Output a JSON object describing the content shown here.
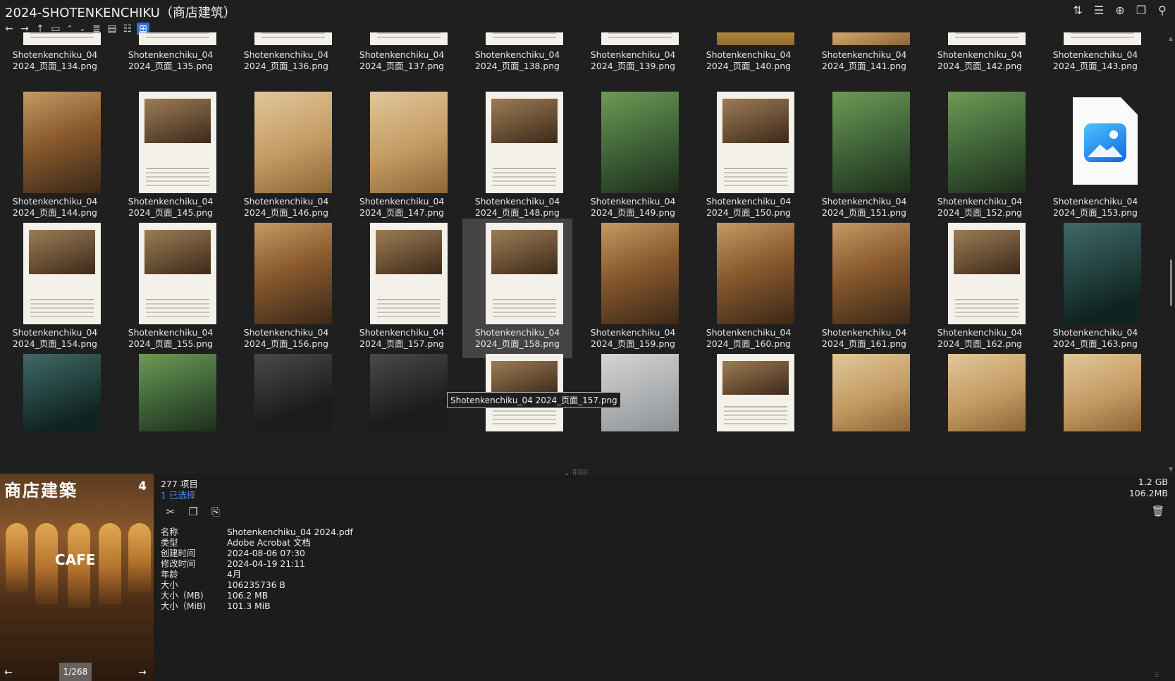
{
  "window": {
    "title": "2024-SHOTENKENCHIKU（商店建筑）",
    "tools": [
      "sort-icon",
      "view-options-icon",
      "add-icon",
      "copy-window-icon",
      "pin-icon"
    ]
  },
  "navbar": [
    "back-icon",
    "forward-icon",
    "up-icon",
    "panel-icon",
    "collapse-icon",
    "expand-icon",
    "details-view-icon",
    "list-view-icon",
    "tree-view-icon",
    "thumbnails-view-icon"
  ],
  "tiles": [
    {
      "line1": "Shotenkenchiku_04",
      "line2": "2024_页面_134.png",
      "style": "paper"
    },
    {
      "line1": "Shotenkenchiku_04",
      "line2": "2024_页面_135.png",
      "style": "paper"
    },
    {
      "line1": "Shotenkenchiku_04",
      "line2": "2024_页面_136.png",
      "style": "paper"
    },
    {
      "line1": "Shotenkenchiku_04",
      "line2": "2024_页面_137.png",
      "style": "paper"
    },
    {
      "line1": "Shotenkenchiku_04",
      "line2": "2024_页面_138.png",
      "style": "paper"
    },
    {
      "line1": "Shotenkenchiku_04",
      "line2": "2024_页面_139.png",
      "style": "paper"
    },
    {
      "line1": "Shotenkenchiku_04",
      "line2": "2024_页面_140.png",
      "style": "shop"
    },
    {
      "line1": "Shotenkenchiku_04",
      "line2": "2024_页面_141.png",
      "style": "wood"
    },
    {
      "line1": "Shotenkenchiku_04",
      "line2": "2024_页面_142.png",
      "style": "paper"
    },
    {
      "line1": "Shotenkenchiku_04",
      "line2": "2024_页面_143.png",
      "style": "paper"
    },
    {
      "line1": "Shotenkenchiku_04",
      "line2": "2024_页面_144.png",
      "style": "photo"
    },
    {
      "line1": "Shotenkenchiku_04",
      "line2": "2024_页面_145.png",
      "style": "paper"
    },
    {
      "line1": "Shotenkenchiku_04",
      "line2": "2024_页面_146.png",
      "style": "wood"
    },
    {
      "line1": "Shotenkenchiku_04",
      "line2": "2024_页面_147.png",
      "style": "wood"
    },
    {
      "line1": "Shotenkenchiku_04",
      "line2": "2024_页面_148.png",
      "style": "paper"
    },
    {
      "line1": "Shotenkenchiku_04",
      "line2": "2024_页面_149.png",
      "style": "green"
    },
    {
      "line1": "Shotenkenchiku_04",
      "line2": "2024_页面_150.png",
      "style": "paper"
    },
    {
      "line1": "Shotenkenchiku_04",
      "line2": "2024_页面_151.png",
      "style": "green"
    },
    {
      "line1": "Shotenkenchiku_04",
      "line2": "2024_页面_152.png",
      "style": "green"
    },
    {
      "line1": "Shotenkenchiku_04",
      "line2": "2024_页面_153.png",
      "style": "icon"
    },
    {
      "line1": "Shotenkenchiku_04",
      "line2": "2024_页面_154.png",
      "style": "paper"
    },
    {
      "line1": "Shotenkenchiku_04",
      "line2": "2024_页面_155.png",
      "style": "paper"
    },
    {
      "line1": "Shotenkenchiku_04",
      "line2": "2024_页面_156.png",
      "style": "photo"
    },
    {
      "line1": "Shotenkenchiku_04",
      "line2": "2024_页面_157.png",
      "style": "paper"
    },
    {
      "line1": "Shotenkenchiku_04",
      "line2": "2024_页面_158.png",
      "style": "paper",
      "selected": true
    },
    {
      "line1": "Shotenkenchiku_04",
      "line2": "2024_页面_159.png",
      "style": "photo"
    },
    {
      "line1": "Shotenkenchiku_04",
      "line2": "2024_页面_160.png",
      "style": "photo"
    },
    {
      "line1": "Shotenkenchiku_04",
      "line2": "2024_页面_161.png",
      "style": "photo"
    },
    {
      "line1": "Shotenkenchiku_04",
      "line2": "2024_页面_162.png",
      "style": "paper"
    },
    {
      "line1": "Shotenkenchiku_04",
      "line2": "2024_页面_163.png",
      "style": "teal"
    },
    {
      "style": "teal"
    },
    {
      "style": "green"
    },
    {
      "style": "dark"
    },
    {
      "style": "dark"
    },
    {
      "style": "paper"
    },
    {
      "style": "grey"
    },
    {
      "style": "paper"
    },
    {
      "style": "wood"
    },
    {
      "style": "wood"
    },
    {
      "style": "wood"
    }
  ],
  "tooltip": "Shotenkenchiku_04 2024_页面_157.png",
  "preview": {
    "cover_title": "商店建築",
    "cover_issue": "4",
    "cover_headline": "CAFE",
    "page_indicator": "1/268"
  },
  "info": {
    "count": "277 项目",
    "selected": "1 已选择",
    "total_size": "1.2 GB",
    "selected_size": "106.2MB",
    "actions": [
      "cut-icon",
      "copy-icon",
      "rename-icon"
    ],
    "properties": [
      {
        "key": "名称",
        "value": "Shotenkenchiku_04 2024.pdf"
      },
      {
        "key": "类型",
        "value": "Adobe Acrobat 文档"
      },
      {
        "key": "创建时间",
        "value": "2024-08-06  07:30"
      },
      {
        "key": "修改时间",
        "value": "2024-04-19  21:11"
      },
      {
        "key": "年龄",
        "value": "4月"
      },
      {
        "key": "大小",
        "value": "106235736 B"
      },
      {
        "key": "大小（MB)",
        "value": "106.2 MB"
      },
      {
        "key": "大小（MiB)",
        "value": "101.3 MiB"
      }
    ]
  }
}
